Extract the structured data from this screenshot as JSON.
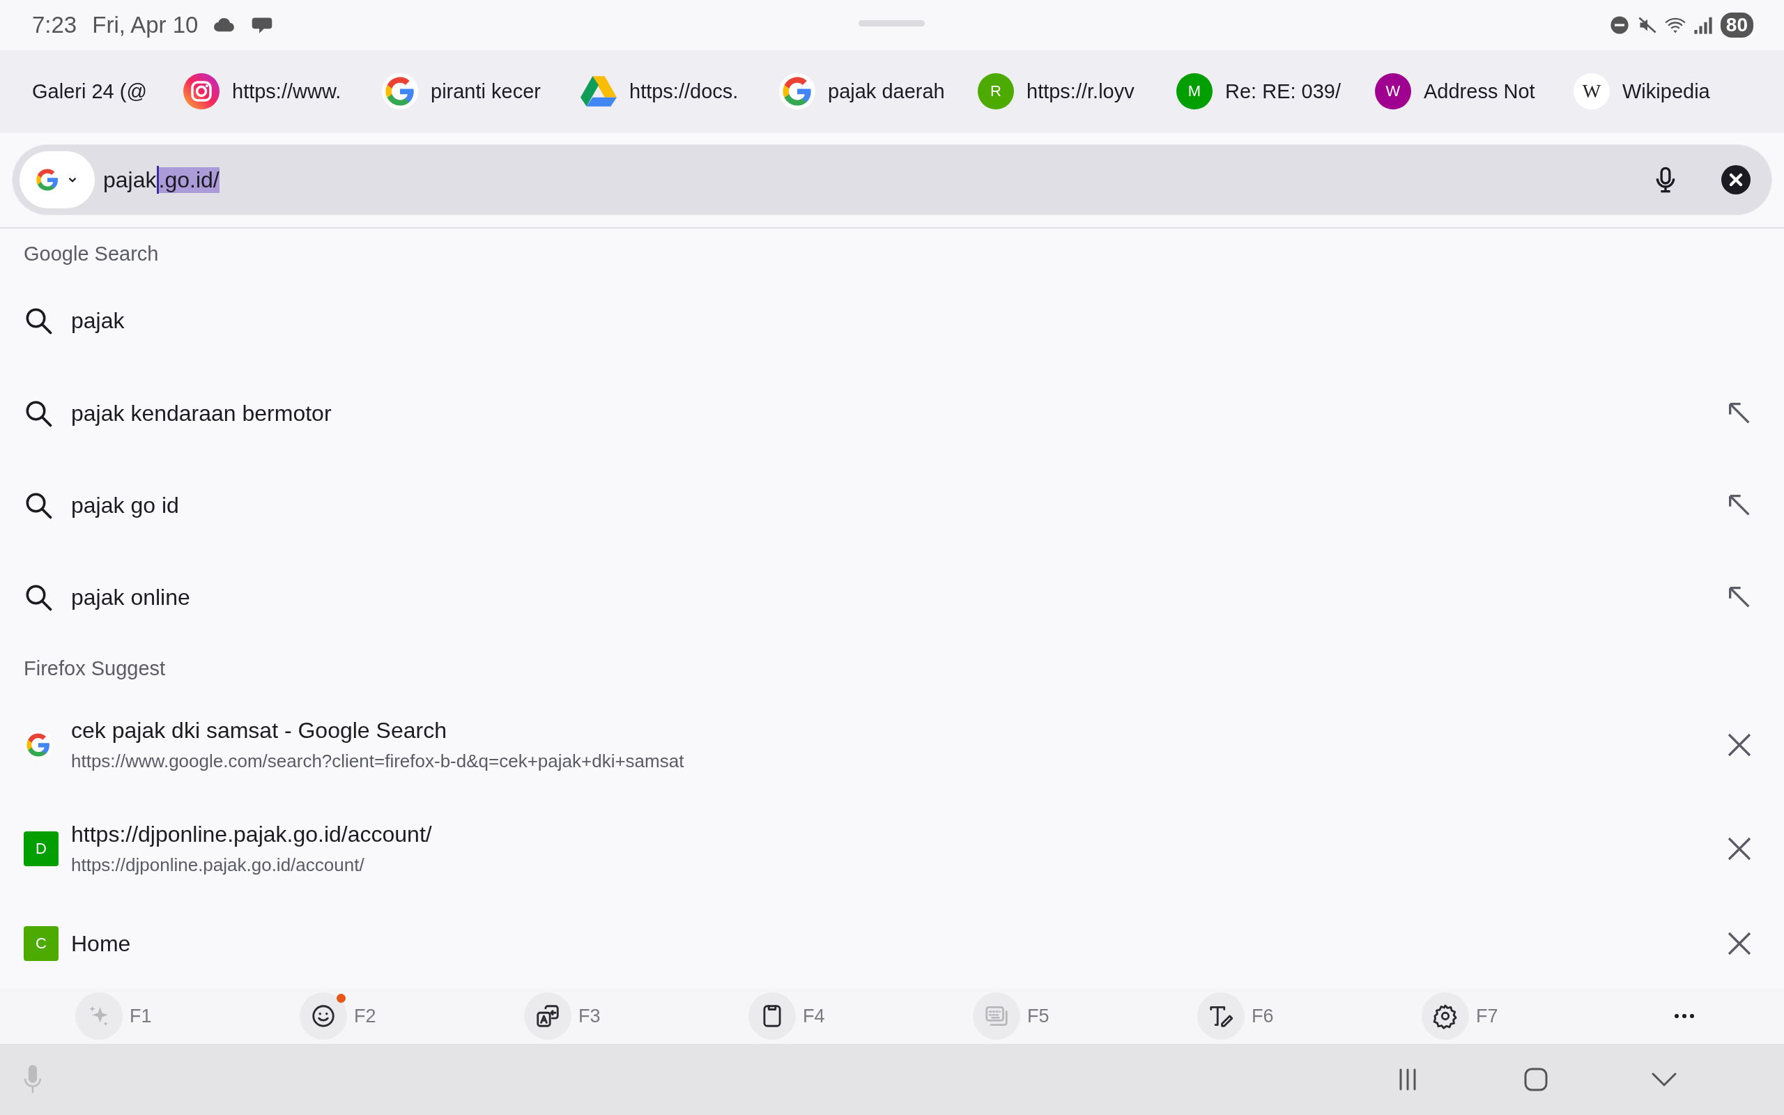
{
  "status_bar": {
    "time": "7:23",
    "date": "Fri, Apr 10",
    "battery": "80"
  },
  "tabs": [
    {
      "kind": "plain",
      "title": "Galeri 24 (@"
    },
    {
      "kind": "instagram",
      "title": "https://www."
    },
    {
      "kind": "google",
      "title": "piranti kecer"
    },
    {
      "kind": "drive",
      "title": "https://docs."
    },
    {
      "kind": "google",
      "title": "pajak daerah"
    },
    {
      "kind": "letter",
      "letter": "R",
      "color": "#4caa00",
      "title": "https://r.loyv"
    },
    {
      "kind": "letter",
      "letter": "M",
      "color": "#039f00",
      "title": "Re: RE: 039/"
    },
    {
      "kind": "letter",
      "letter": "W",
      "color": "#a0008f",
      "title": "Address Not"
    },
    {
      "kind": "wikipedia",
      "letter": "W",
      "title": "Wikipedia"
    }
  ],
  "address_bar": {
    "typed": "pajak",
    "autocomplete": ".go.id/"
  },
  "sections": [
    {
      "title": "Google Search",
      "items": [
        {
          "kind": "search",
          "title": "pajak",
          "fill_button": false
        },
        {
          "kind": "search",
          "title": "pajak kendaraan bermotor",
          "fill_button": true
        },
        {
          "kind": "search",
          "title": "pajak go id",
          "fill_button": true
        },
        {
          "kind": "search",
          "title": "pajak online",
          "fill_button": true
        }
      ]
    },
    {
      "title": "Firefox Suggest",
      "items": [
        {
          "kind": "google",
          "title": "cek pajak dki samsat - Google Search",
          "url": "https://www.google.com/search?client=firefox-b-d&q=cek+pajak+dki+samsat"
        },
        {
          "kind": "letter",
          "letter": "D",
          "color": "#039f00",
          "title": "https://djponline.pajak.go.id/account/",
          "url": "https://djponline.pajak.go.id/account/"
        },
        {
          "kind": "letter",
          "letter": "C",
          "color": "#4caa00",
          "title": "Home"
        }
      ]
    }
  ],
  "keyboard_toolbar": [
    {
      "label": "F1",
      "dimmed": true,
      "badge": false
    },
    {
      "label": "F2",
      "dimmed": false,
      "badge": true
    },
    {
      "label": "F3",
      "dimmed": false,
      "badge": false
    },
    {
      "label": "F4",
      "dimmed": false,
      "badge": false
    },
    {
      "label": "F5",
      "dimmed": true,
      "badge": false
    },
    {
      "label": "F6",
      "dimmed": false,
      "badge": false
    },
    {
      "label": "F7",
      "dimmed": false,
      "badge": false
    }
  ]
}
